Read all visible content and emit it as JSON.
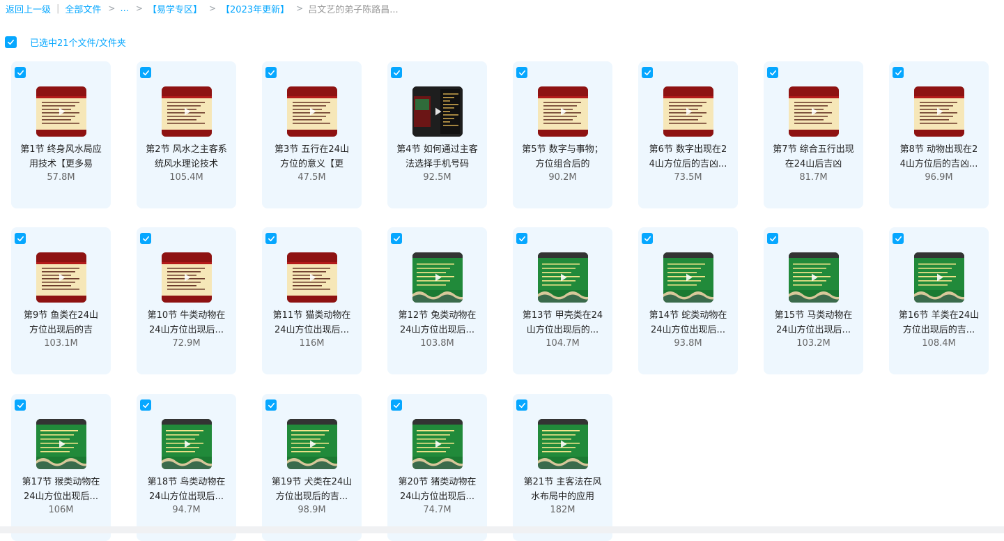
{
  "breadcrumb": {
    "back": "返回上一级",
    "all_files": "全部文件",
    "ellipsis": "...",
    "folder1": "【易学专区】",
    "folder2": "【2023年更新】",
    "current": "吕文艺的弟子陈路昌..."
  },
  "selection": {
    "label": "已选中21个文件/文件夹"
  },
  "colors": {
    "accent": "#06a7ff",
    "card_bg": "#eef7fe"
  },
  "files": [
    {
      "name": "第1节 终身风水局应用技术【更多易",
      "size": "57.8M",
      "thumb": "red"
    },
    {
      "name": "第2节 风水之主客系统风水理论技术",
      "size": "105.4M",
      "thumb": "red"
    },
    {
      "name": "第3节 五行在24山方位的意义【更",
      "size": "47.5M",
      "thumb": "red"
    },
    {
      "name": "第4节 如何通过主客法选择手机号码",
      "size": "92.5M",
      "thumb": "dark"
    },
    {
      "name": "第5节 数字与事物；方位组合后的",
      "size": "90.2M",
      "thumb": "red"
    },
    {
      "name": "第6节 数字出现在24山方位后的吉凶...",
      "size": "73.5M",
      "thumb": "red"
    },
    {
      "name": "第7节 综合五行出现在24山后吉凶",
      "size": "81.7M",
      "thumb": "red"
    },
    {
      "name": "第8节 动物出现在24山方位后的吉凶...",
      "size": "96.9M",
      "thumb": "red"
    },
    {
      "name": "第9节 鱼类在24山方位出现后的吉",
      "size": "103.1M",
      "thumb": "red"
    },
    {
      "name": "第10节 牛类动物在24山方位出现后...",
      "size": "72.9M",
      "thumb": "red"
    },
    {
      "name": "第11节 猫类动物在24山方位出现后...",
      "size": "116M",
      "thumb": "red"
    },
    {
      "name": "第12节 兔类动物在24山方位出现后...",
      "size": "103.8M",
      "thumb": "green"
    },
    {
      "name": "第13节 甲壳类在24山方位出现后的...",
      "size": "104.7M",
      "thumb": "green"
    },
    {
      "name": "第14节 蛇类动物在24山方位出现后...",
      "size": "93.8M",
      "thumb": "green"
    },
    {
      "name": "第15节 马类动物在24山方位出现后...",
      "size": "103.2M",
      "thumb": "green"
    },
    {
      "name": "第16节 羊类在24山方位出现后的吉...",
      "size": "108.4M",
      "thumb": "green"
    },
    {
      "name": "第17节 猴类动物在24山方位出现后...",
      "size": "106M",
      "thumb": "green"
    },
    {
      "name": "第18节 鸟类动物在24山方位出现后...",
      "size": "94.7M",
      "thumb": "green"
    },
    {
      "name": "第19节 犬类在24山方位出现后的吉...",
      "size": "98.9M",
      "thumb": "green"
    },
    {
      "name": "第20节 猪类动物在24山方位出现后...",
      "size": "74.7M",
      "thumb": "green"
    },
    {
      "name": "第21节 主客法在风水布局中的应用",
      "size": "182M",
      "thumb": "green"
    }
  ]
}
